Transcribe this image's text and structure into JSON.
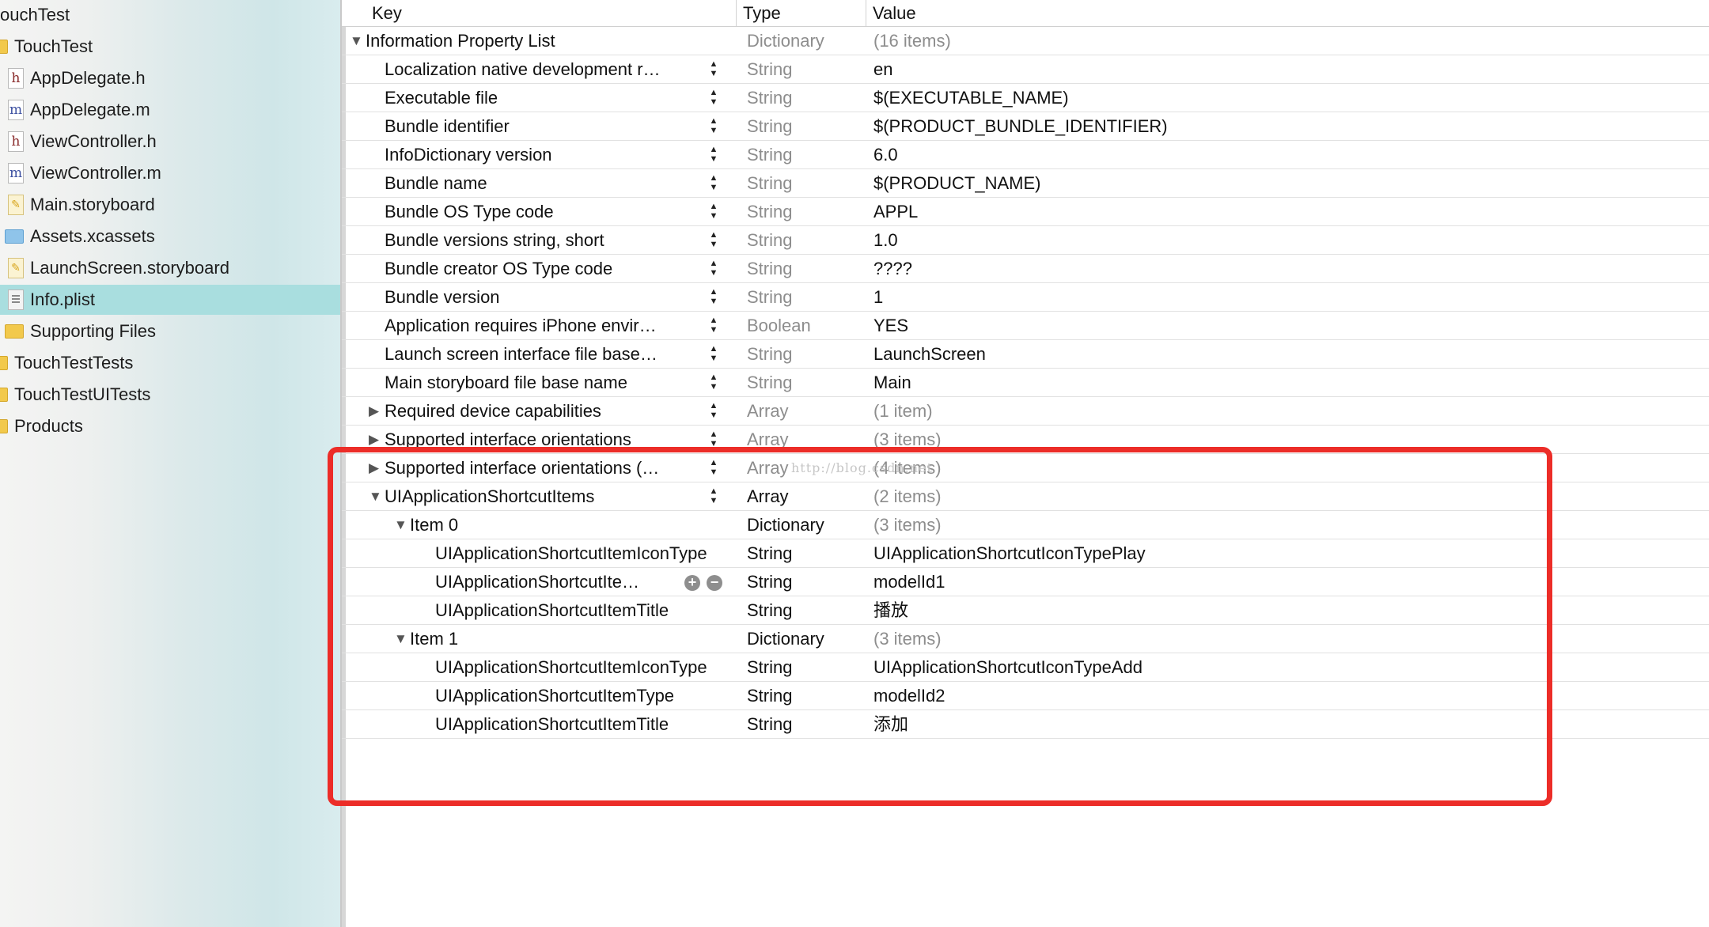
{
  "sidebar": {
    "items": [
      {
        "label": "ouchTest",
        "icon": "none"
      },
      {
        "label": "TouchTest",
        "icon": "folder-stub"
      },
      {
        "label": "AppDelegate.h",
        "icon": "h-file"
      },
      {
        "label": "AppDelegate.m",
        "icon": "m-file"
      },
      {
        "label": "ViewController.h",
        "icon": "h-file"
      },
      {
        "label": "ViewController.m",
        "icon": "m-file"
      },
      {
        "label": "Main.storyboard",
        "icon": "storyboard-file"
      },
      {
        "label": "Assets.xcassets",
        "icon": "blue-folder"
      },
      {
        "label": "LaunchScreen.storyboard",
        "icon": "storyboard-file"
      },
      {
        "label": "Info.plist",
        "icon": "plist-file",
        "selected": true
      },
      {
        "label": "Supporting Files",
        "icon": "folder"
      },
      {
        "label": "TouchTestTests",
        "icon": "folder-stub"
      },
      {
        "label": "TouchTestUITests",
        "icon": "folder-stub"
      },
      {
        "label": "Products",
        "icon": "folder-stub"
      }
    ]
  },
  "editor": {
    "columns": {
      "key": "Key",
      "type": "Type",
      "value": "Value"
    },
    "rows": [
      {
        "key": "Information Property List",
        "type": "Dictionary",
        "value": "(16 items)",
        "level": 0,
        "disclosure": "open",
        "stepper": false,
        "type_muted": true,
        "value_muted": true
      },
      {
        "key": "Localization native development r…",
        "type": "String",
        "value": "en",
        "level": 1,
        "disclosure": "none",
        "stepper": true,
        "type_muted": true,
        "value_muted": false
      },
      {
        "key": "Executable file",
        "type": "String",
        "value": "$(EXECUTABLE_NAME)",
        "level": 1,
        "disclosure": "none",
        "stepper": true,
        "type_muted": true,
        "value_muted": false
      },
      {
        "key": "Bundle identifier",
        "type": "String",
        "value": "$(PRODUCT_BUNDLE_IDENTIFIER)",
        "level": 1,
        "disclosure": "none",
        "stepper": true,
        "type_muted": true,
        "value_muted": false
      },
      {
        "key": "InfoDictionary version",
        "type": "String",
        "value": "6.0",
        "level": 1,
        "disclosure": "none",
        "stepper": true,
        "type_muted": true,
        "value_muted": false
      },
      {
        "key": "Bundle name",
        "type": "String",
        "value": "$(PRODUCT_NAME)",
        "level": 1,
        "disclosure": "none",
        "stepper": true,
        "type_muted": true,
        "value_muted": false
      },
      {
        "key": "Bundle OS Type code",
        "type": "String",
        "value": "APPL",
        "level": 1,
        "disclosure": "none",
        "stepper": true,
        "type_muted": true,
        "value_muted": false
      },
      {
        "key": "Bundle versions string, short",
        "type": "String",
        "value": "1.0",
        "level": 1,
        "disclosure": "none",
        "stepper": true,
        "type_muted": true,
        "value_muted": false
      },
      {
        "key": "Bundle creator OS Type code",
        "type": "String",
        "value": "????",
        "level": 1,
        "disclosure": "none",
        "stepper": true,
        "type_muted": true,
        "value_muted": false
      },
      {
        "key": "Bundle version",
        "type": "String",
        "value": "1",
        "level": 1,
        "disclosure": "none",
        "stepper": true,
        "type_muted": true,
        "value_muted": false
      },
      {
        "key": "Application requires iPhone envir…",
        "type": "Boolean",
        "value": "YES",
        "level": 1,
        "disclosure": "none",
        "stepper": true,
        "type_muted": true,
        "value_muted": false
      },
      {
        "key": "Launch screen interface file base…",
        "type": "String",
        "value": "LaunchScreen",
        "level": 1,
        "disclosure": "none",
        "stepper": true,
        "type_muted": true,
        "value_muted": false
      },
      {
        "key": "Main storyboard file base name",
        "type": "String",
        "value": "Main",
        "level": 1,
        "disclosure": "none",
        "stepper": true,
        "type_muted": true,
        "value_muted": false
      },
      {
        "key": "Required device capabilities",
        "type": "Array",
        "value": "(1 item)",
        "level": 1,
        "disclosure": "closed",
        "stepper": true,
        "type_muted": true,
        "value_muted": true
      },
      {
        "key": "Supported interface orientations",
        "type": "Array",
        "value": "(3 items)",
        "level": 1,
        "disclosure": "closed",
        "stepper": true,
        "type_muted": true,
        "value_muted": true
      },
      {
        "key": "Supported interface orientations (…",
        "type": "Array",
        "value": "(4 items)",
        "level": 1,
        "disclosure": "closed",
        "stepper": true,
        "type_muted": true,
        "value_muted": true
      },
      {
        "key": "UIApplicationShortcutItems",
        "type": "Array",
        "value": "(2 items)",
        "level": 1,
        "disclosure": "open",
        "stepper": true,
        "type_muted": false,
        "value_muted": true
      },
      {
        "key": "Item 0",
        "type": "Dictionary",
        "value": "(3 items)",
        "level": 2,
        "disclosure": "open",
        "stepper": false,
        "type_muted": false,
        "value_muted": true
      },
      {
        "key": "UIApplicationShortcutItemIconType",
        "type": "String",
        "value": "UIApplicationShortcutIconTypePlay",
        "level": 3,
        "disclosure": "none",
        "stepper": false,
        "type_muted": false,
        "value_muted": false
      },
      {
        "key": "UIApplicationShortcutIte…",
        "type": "String",
        "value": "modelId1",
        "level": 3,
        "disclosure": "none",
        "stepper": false,
        "add_remove": true,
        "type_muted": false,
        "value_muted": false
      },
      {
        "key": "UIApplicationShortcutItemTitle",
        "type": "String",
        "value": "播放",
        "level": 3,
        "disclosure": "none",
        "stepper": false,
        "type_muted": false,
        "value_muted": false
      },
      {
        "key": "Item 1",
        "type": "Dictionary",
        "value": "(3 items)",
        "level": 2,
        "disclosure": "open",
        "stepper": false,
        "type_muted": false,
        "value_muted": true
      },
      {
        "key": "UIApplicationShortcutItemIconType",
        "type": "String",
        "value": "UIApplicationShortcutIconTypeAdd",
        "level": 3,
        "disclosure": "none",
        "stepper": false,
        "type_muted": false,
        "value_muted": false
      },
      {
        "key": "UIApplicationShortcutItemType",
        "type": "String",
        "value": "modelId2",
        "level": 3,
        "disclosure": "none",
        "stepper": false,
        "type_muted": false,
        "value_muted": false
      },
      {
        "key": "UIApplicationShortcutItemTitle",
        "type": "String",
        "value": "添加",
        "level": 3,
        "disclosure": "none",
        "stepper": false,
        "type_muted": false,
        "value_muted": false
      }
    ],
    "add_icon": "plus-circle-icon",
    "remove_icon": "minus-circle-icon"
  },
  "watermark": "http://blog.csdn.net",
  "annotation": {
    "highlight_color": "#ec2d28"
  },
  "colors": {
    "selection": "#a9dedf",
    "muted_text": "#8d8d8d",
    "folder": "#f2c94c"
  }
}
